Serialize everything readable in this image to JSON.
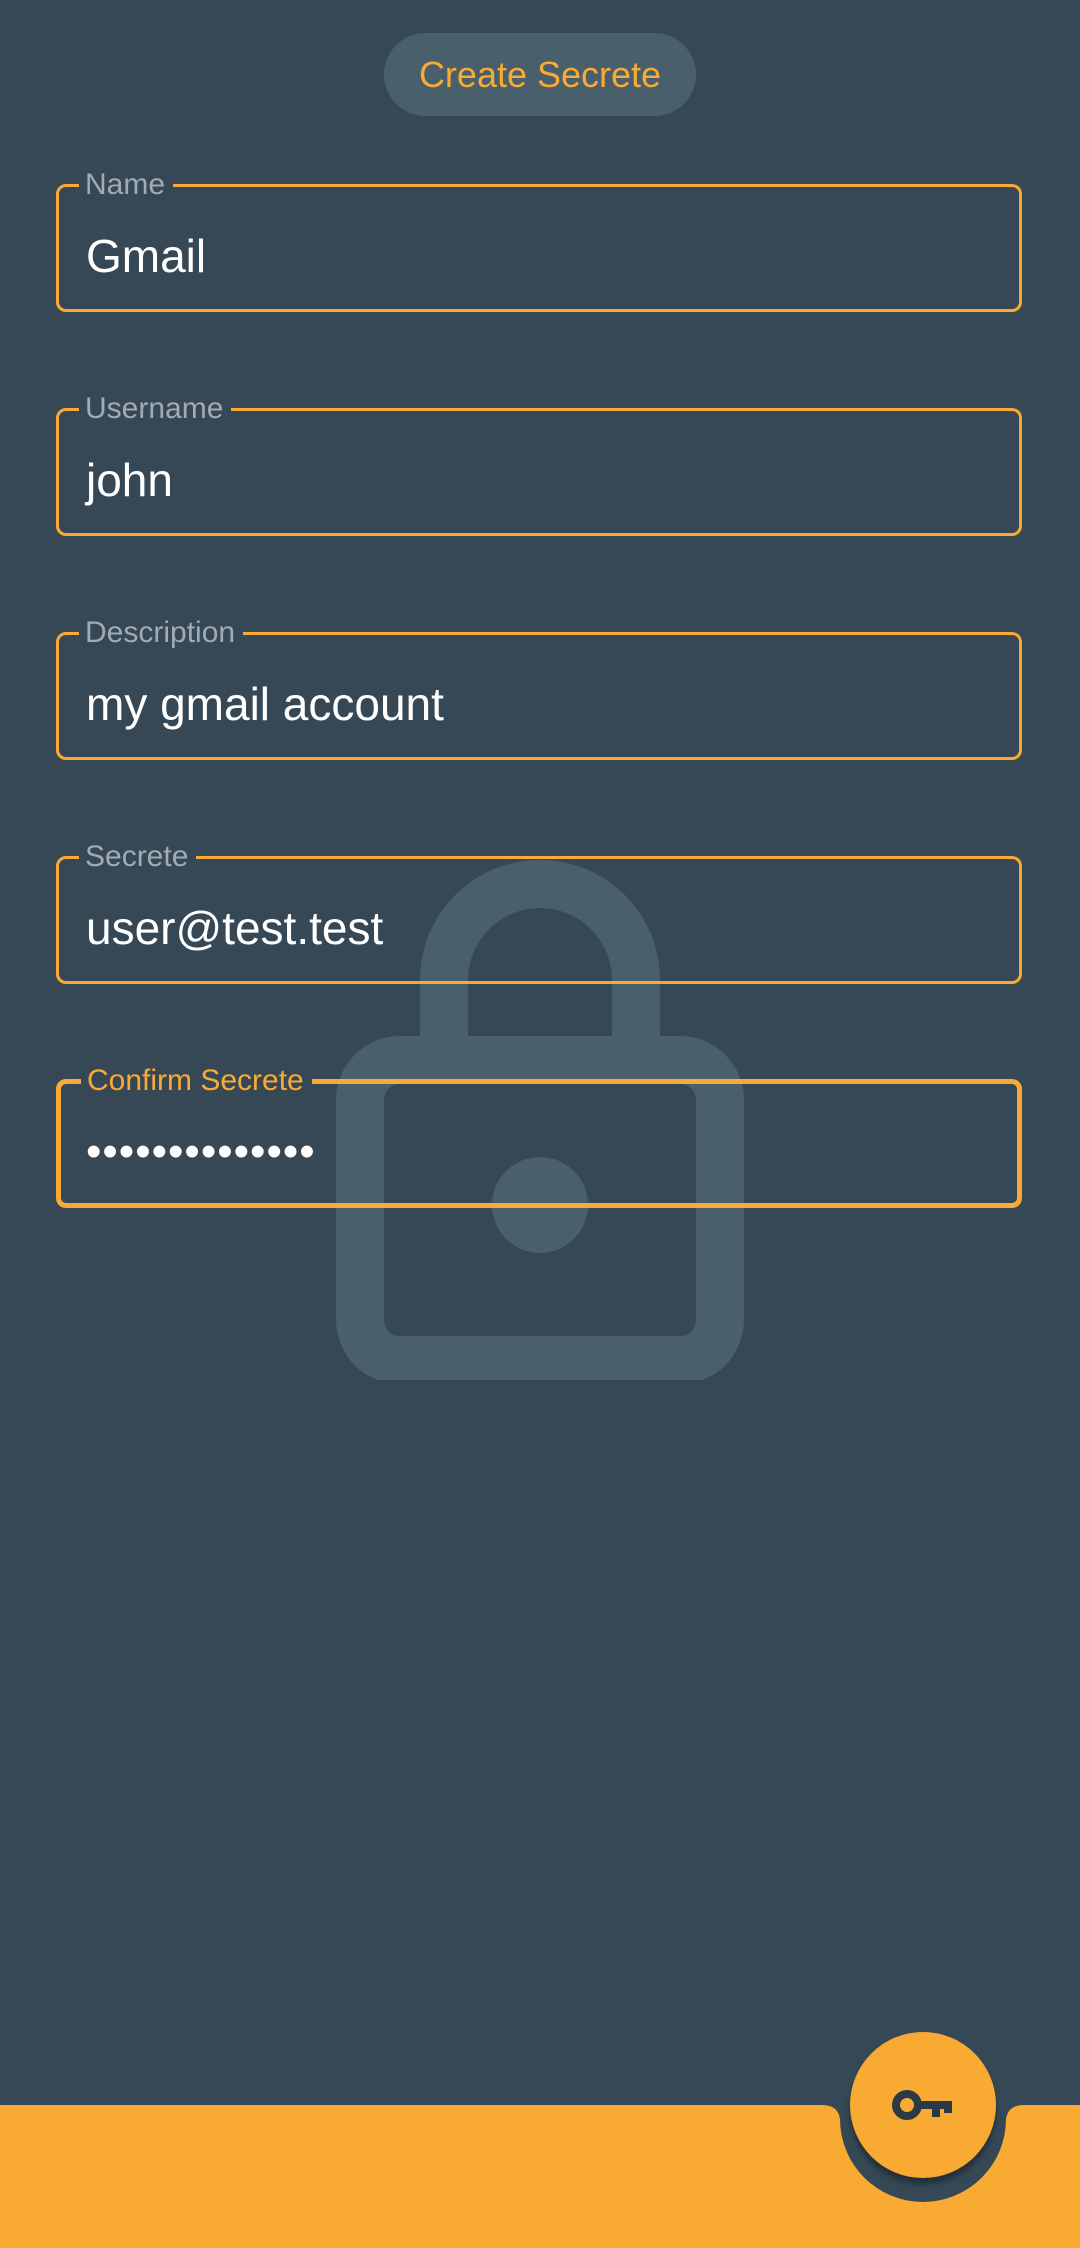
{
  "header": {
    "title": "Create Secrete"
  },
  "form": {
    "fields": [
      {
        "label": "Name",
        "value": "Gmail"
      },
      {
        "label": "Username",
        "value": "john"
      },
      {
        "label": "Description",
        "value": "my gmail account"
      },
      {
        "label": "Secrete",
        "value": "user@test.test"
      },
      {
        "label": "Confirm Secrete",
        "value": "••••••••••••••"
      }
    ]
  },
  "fab": {
    "icon": "key-icon"
  },
  "background": {
    "icon": "lock-icon"
  },
  "colors": {
    "background": "#364855",
    "accent": "#f9aa33",
    "pill": "#495f6c",
    "label": "#a0abb3",
    "watermark": "#495f6c"
  }
}
